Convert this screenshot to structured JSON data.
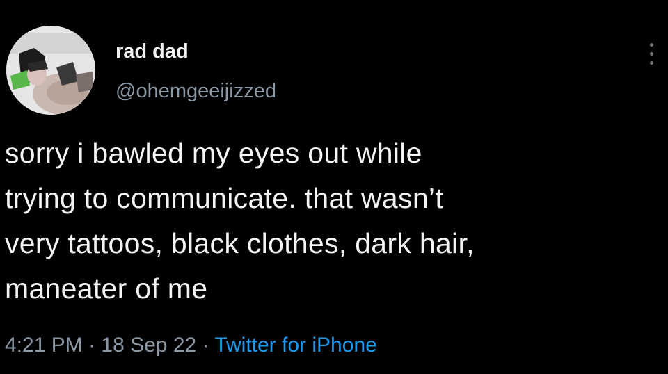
{
  "user": {
    "display_name": "rad dad",
    "handle": "@ohemgeeijizzed",
    "avatar": "profile-photo"
  },
  "tweet": {
    "lines": [
      "sorry i bawled my eyes out while",
      "trying to communicate. that wasn’t",
      "very tattoos, black clothes, dark hair,",
      "maneater of me"
    ]
  },
  "meta": {
    "time": "4:21 PM",
    "sep1": " · ",
    "date": "18 Sep 22",
    "sep2": " · ",
    "source": "Twitter for iPhone"
  },
  "icons": {
    "more": "more-vertical-icon"
  },
  "colors": {
    "background": "#000000",
    "text": "#f4f4f4",
    "secondary": "#8b98a5",
    "link": "#1d9bf0"
  }
}
